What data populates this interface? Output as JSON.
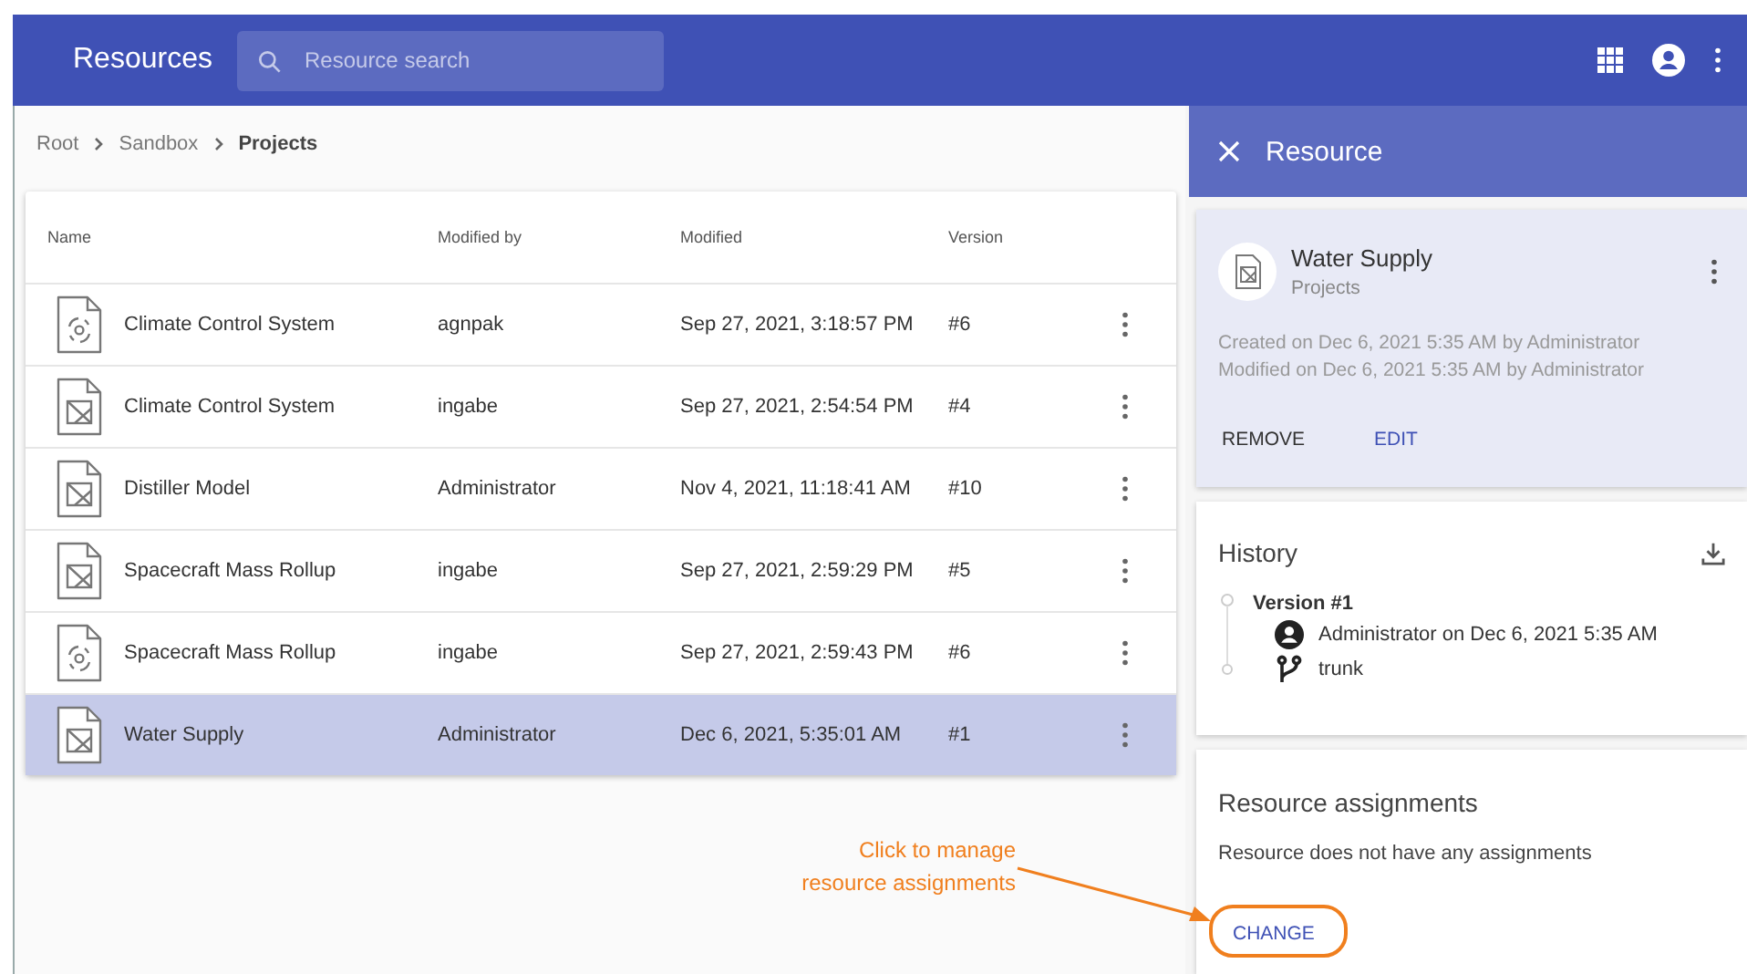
{
  "app_bar": {
    "title": "Resources",
    "search": {
      "placeholder": "Resource search"
    }
  },
  "breadcrumb": [
    {
      "label": "Root",
      "current": false
    },
    {
      "label": "Sandbox",
      "current": false
    },
    {
      "label": "Projects",
      "current": true
    }
  ],
  "table": {
    "columns": [
      "Name",
      "Modified by",
      "Modified",
      "Version"
    ],
    "rows": [
      {
        "kind": "simulation",
        "name": "Climate Control System",
        "modified_by": "agnpak",
        "modified": "Sep 27, 2021, 3:18:57 PM",
        "version": "#6",
        "selected": false
      },
      {
        "kind": "model",
        "name": "Climate Control System",
        "modified_by": "ingabe",
        "modified": "Sep 27, 2021, 2:54:54 PM",
        "version": "#4",
        "selected": false
      },
      {
        "kind": "model",
        "name": "Distiller Model",
        "modified_by": "Administrator",
        "modified": "Nov 4, 2021, 11:18:41 AM",
        "version": "#10",
        "selected": false
      },
      {
        "kind": "model",
        "name": "Spacecraft Mass Rollup",
        "modified_by": "ingabe",
        "modified": "Sep 27, 2021, 2:59:29 PM",
        "version": "#5",
        "selected": false
      },
      {
        "kind": "simulation",
        "name": "Spacecraft Mass Rollup",
        "modified_by": "ingabe",
        "modified": "Sep 27, 2021, 2:59:43 PM",
        "version": "#6",
        "selected": false
      },
      {
        "kind": "model",
        "name": "Water Supply",
        "modified_by": "Administrator",
        "modified": "Dec 6, 2021, 5:35:01 AM",
        "version": "#1",
        "selected": true
      }
    ]
  },
  "panel": {
    "title": "Resource",
    "resource": {
      "name": "Water Supply",
      "folder": "Projects",
      "created": "Created on Dec 6, 2021 5:35 AM by Administrator",
      "modified": "Modified on Dec 6, 2021 5:35 AM by Administrator",
      "actions": [
        "REMOVE",
        "EDIT"
      ]
    },
    "history": {
      "title": "History",
      "versions": [
        {
          "label": "Version #1",
          "author": "Administrator on Dec 6, 2021 5:35 AM",
          "branch": "trunk"
        }
      ]
    },
    "assignments": {
      "title": "Resource assignments",
      "message": "Resource does not have any assignments",
      "button": "CHANGE"
    }
  },
  "annotation": {
    "lines": [
      "Click to manage",
      "resource assignments"
    ]
  }
}
